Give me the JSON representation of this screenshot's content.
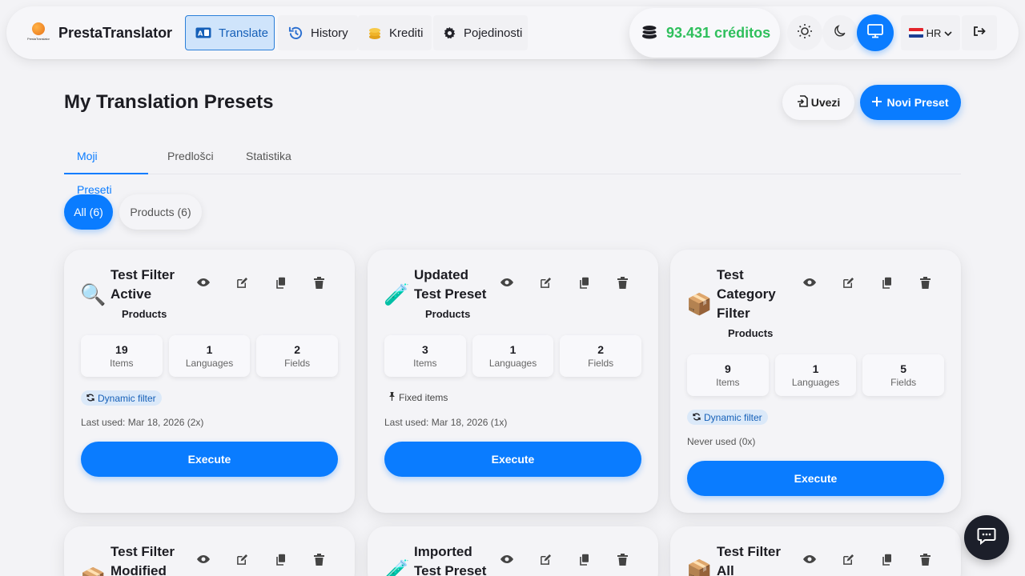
{
  "brand": {
    "name": "PrestaTranslator",
    "logo_text": "PrestaTranslator"
  },
  "nav": {
    "tabs": [
      {
        "label": "Translate",
        "icon": "translate-icon"
      },
      {
        "label": "History",
        "icon": "history-icon"
      },
      {
        "label": "Krediti",
        "icon": "coins-icon"
      },
      {
        "label": "Pojedinosti",
        "icon": "gear-icon"
      }
    ],
    "credits": "93.431 créditos",
    "language": "HR"
  },
  "colors": {
    "accent": "#0a7cff",
    "credits": "#2fbf5c",
    "background": "#f3f3f6"
  },
  "page": {
    "title": "My Translation Presets",
    "import_label": "Uvezi",
    "new_label": "Novi Preset"
  },
  "tabs": [
    "Moji Preseti",
    "Predlošci",
    "Statistika"
  ],
  "filters": [
    "All (6)",
    "Products (6)"
  ],
  "cards": [
    {
      "emoji": "🔍",
      "title": "Test Filter Active",
      "category": "Products",
      "stats": [
        {
          "num": "19",
          "label": "Items"
        },
        {
          "num": "1",
          "label": "Languages"
        },
        {
          "num": "2",
          "label": "Fields"
        }
      ],
      "mode": "Dynamic filter",
      "usage": "Last used: Mar 18, 2026  (2x)",
      "execute": "Execute"
    },
    {
      "emoji": "🧪",
      "title": "Updated Test Preset",
      "category": "Products",
      "stats": [
        {
          "num": "3",
          "label": "Items"
        },
        {
          "num": "1",
          "label": "Languages"
        },
        {
          "num": "2",
          "label": "Fields"
        }
      ],
      "mode": "Fixed items",
      "usage": "Last used: Mar 18, 2026  (1x)",
      "execute": "Execute"
    },
    {
      "emoji": "📦",
      "title": "Test Category Filter",
      "category": "Products",
      "stats": [
        {
          "num": "9",
          "label": "Items"
        },
        {
          "num": "1",
          "label": "Languages"
        },
        {
          "num": "5",
          "label": "Fields"
        }
      ],
      "mode": "Dynamic filter",
      "usage": "Never used  (0x)",
      "execute": "Execute"
    },
    {
      "emoji": "📦",
      "title": "Test Filter Modified"
    },
    {
      "emoji": "🧪",
      "title": "Imported Test Preset"
    },
    {
      "emoji": "📦",
      "title": "Test Filter All"
    }
  ]
}
